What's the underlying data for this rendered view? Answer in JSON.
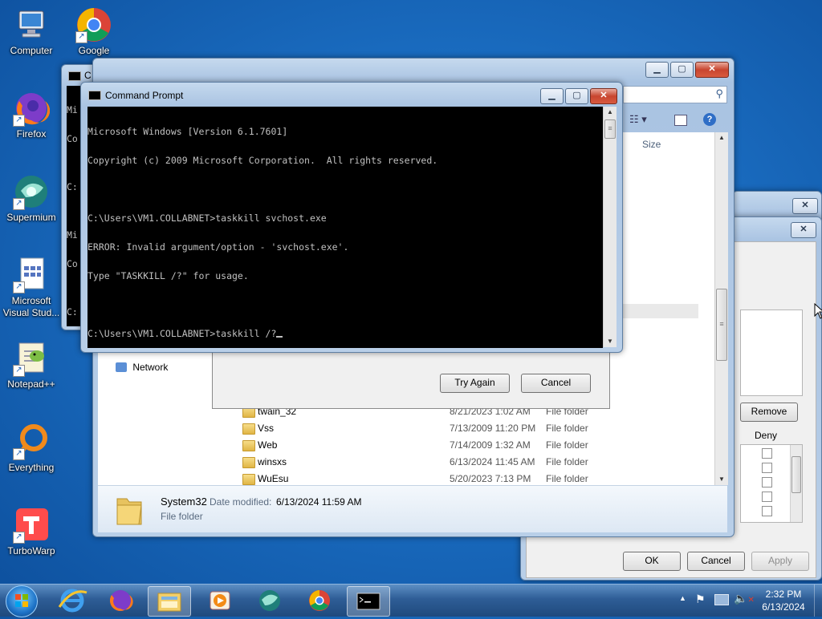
{
  "desktop_icons": [
    {
      "label": "Computer",
      "icon": "computer-icon"
    },
    {
      "label": "Google",
      "icon": "chrome-icon"
    },
    {
      "label": "Firefox",
      "icon": "firefox-icon"
    },
    {
      "label": "Supermium",
      "icon": "supermium-icon"
    },
    {
      "label": "Microsoft Visual Stud...",
      "icon": "visual-studio-icon"
    },
    {
      "label": "Notepad++",
      "icon": "notepadpp-icon"
    },
    {
      "label": "Everything",
      "icon": "everything-icon"
    },
    {
      "label": "TurboWarp",
      "icon": "turbowarp-icon"
    }
  ],
  "back_cmd": {
    "title_fragment": "C",
    "lines": [
      "Mi",
      "Co",
      "",
      "C:",
      "",
      "Mi",
      "Co",
      "",
      "C:"
    ]
  },
  "cmd_window": {
    "title": "Command Prompt",
    "lines": [
      "Microsoft Windows [Version 6.1.7601]",
      "Copyright (c) 2009 Microsoft Corporation.  All rights reserved.",
      "",
      "C:\\Users\\VM1.COLLABNET>taskkill svchost.exe",
      "ERROR: Invalid argument/option - 'svchost.exe'.",
      "Type \"TASKKILL /?\" for usage.",
      "",
      "C:\\Users\\VM1.COLLABNET>taskkill /?"
    ]
  },
  "explorer": {
    "column_size": "Size",
    "nav_network": "Network",
    "files": [
      {
        "name": "twain_32",
        "date": "8/21/2023 1:02 AM",
        "type": "File folder"
      },
      {
        "name": "Vss",
        "date": "7/13/2009 11:20 PM",
        "type": "File folder"
      },
      {
        "name": "Web",
        "date": "7/14/2009 1:32 AM",
        "type": "File folder"
      },
      {
        "name": "winsxs",
        "date": "6/13/2024 11:45 AM",
        "type": "File folder"
      },
      {
        "name": "WuEsu",
        "date": "5/20/2023 7:13 PM",
        "type": "File folder"
      }
    ],
    "details": {
      "name": "System32",
      "date_label": "Date modified:",
      "date": "6/13/2024 11:59 AM",
      "type": "File folder"
    }
  },
  "error_dialog": {
    "try_again": "Try Again",
    "cancel": "Cancel"
  },
  "security_dialog": {
    "remove": "Remove",
    "deny": "Deny",
    "ok": "OK",
    "cancel": "Cancel",
    "apply": "Apply"
  },
  "taskbar": {
    "items": [
      "start-orb",
      "internet-explorer-icon",
      "firefox-icon",
      "file-explorer-icon",
      "media-player-icon",
      "supermium-icon",
      "chrome-icon",
      "command-prompt-icon"
    ],
    "time": "2:32 PM",
    "date": "6/13/2024"
  },
  "colors": {
    "desktop": "#1a6cc0",
    "console_bg": "#000000",
    "console_fg": "#c0c0c0",
    "close_red": "#c8452f"
  }
}
